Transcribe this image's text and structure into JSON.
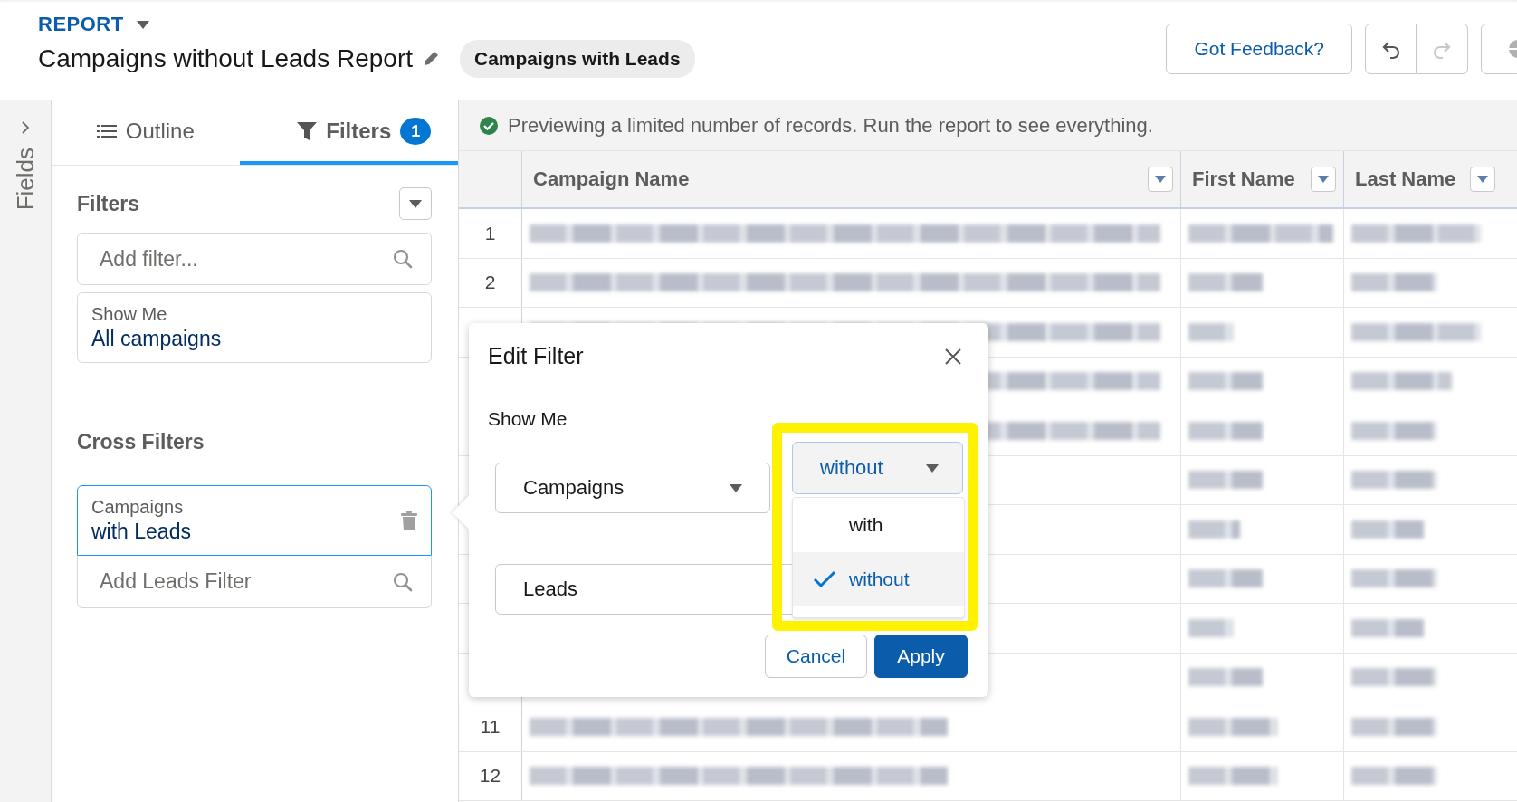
{
  "header": {
    "type_label": "REPORT",
    "title": "Campaigns without Leads Report",
    "report_type": "Campaigns with Leads",
    "feedback_button": "Got Feedback?",
    "redo_disabled": true
  },
  "fields_panel": {
    "label": "Fields"
  },
  "tabs": [
    {
      "label": "Outline",
      "selected": false
    },
    {
      "label": "Filters",
      "selected": true,
      "badge": "1"
    }
  ],
  "filters": {
    "heading": "Filters",
    "add_placeholder": "Add filter...",
    "show_me": {
      "label": "Show Me",
      "value": "All campaigns"
    }
  },
  "cross_filters": {
    "heading": "Cross Filters",
    "items": [
      {
        "object": "Campaigns",
        "condition": "with Leads",
        "selected": true
      }
    ],
    "add_placeholder": "Add Leads Filter"
  },
  "banner": "Previewing a limited number of records. Run the report to see everything.",
  "table": {
    "columns": [
      "Campaign Name",
      "First Name",
      "Last Name"
    ],
    "rows": [
      {
        "number": "1"
      },
      {
        "number": "2"
      },
      {
        "number": "11"
      },
      {
        "number": "12"
      }
    ]
  },
  "edit_filter": {
    "title": "Edit Filter",
    "show_me_label": "Show Me",
    "object_select": "Campaigns",
    "relation_select": "without",
    "related_object": "Leads",
    "options": [
      {
        "label": "with",
        "selected": false
      },
      {
        "label": "without",
        "selected": true
      }
    ],
    "highlighted": true,
    "cancel": "Cancel",
    "apply": "Apply"
  }
}
